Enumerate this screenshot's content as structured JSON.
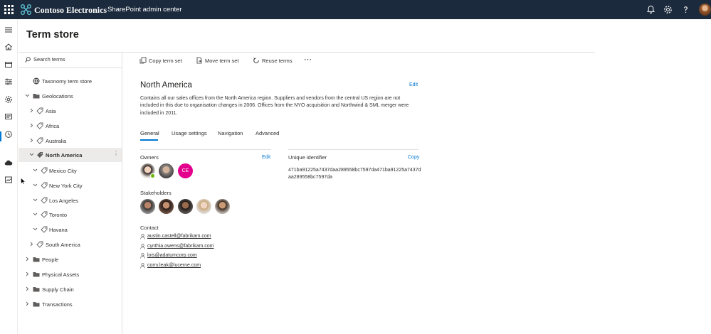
{
  "header": {
    "org_name": "Contoso Electronics",
    "app_name": "SharePoint admin center",
    "icons": [
      "waffle-icon",
      "bell-icon",
      "gear-icon",
      "help-icon",
      "profile-avatar"
    ]
  },
  "left_rail": {
    "icons": [
      "hamburger-icon",
      "home-icon",
      "sites-icon",
      "policies-icon",
      "settings-icon",
      "content-services-icon",
      "migration-icon",
      "more-features-icon",
      "onedrive-icon",
      "reports-icon"
    ],
    "active": "content-services-icon"
  },
  "page": {
    "title": "Term store"
  },
  "tree": {
    "search_placeholder": "Search terms",
    "items": [
      {
        "label": "Taxonomy term store",
        "icon": "globe-icon"
      },
      {
        "label": "Geolocations",
        "icon": "folder-icon",
        "expanded": true
      },
      {
        "label": "Asia",
        "icon": "term-set-icon"
      },
      {
        "label": "Africa",
        "icon": "term-set-icon"
      },
      {
        "label": "Australia",
        "icon": "term-set-icon"
      },
      {
        "label": "North America",
        "icon": "term-set-icon",
        "selected": true,
        "expanded": true
      },
      {
        "label": "Mexico City",
        "icon": "term-icon"
      },
      {
        "label": "New York City",
        "icon": "term-icon"
      },
      {
        "label": "Los Angeles",
        "icon": "term-icon"
      },
      {
        "label": "Toronto",
        "icon": "term-icon"
      },
      {
        "label": "Havana",
        "icon": "term-icon"
      },
      {
        "label": "South America",
        "icon": "term-set-icon"
      },
      {
        "label": "People",
        "icon": "folder-icon"
      },
      {
        "label": "Physical Assets",
        "icon": "folder-icon"
      },
      {
        "label": "Supply Chain",
        "icon": "folder-icon"
      },
      {
        "label": "Transactions",
        "icon": "folder-icon"
      }
    ]
  },
  "command_bar": {
    "copy_term_set": "Copy term set",
    "move_term_set": "Move term set",
    "reuse_terms": "Reuse terms",
    "more": "⋯"
  },
  "detail": {
    "title": "North America",
    "edit_label": "Edit",
    "description": "Contains all our sales offices from the North America region. Suppliers and vendors from the central US region are not included in this due to organisation changes in 2006. Offices from the NYO acquisition and Northwind & SML merger were included in 2011.",
    "tabs": [
      "General",
      "Usage settings",
      "Navigation",
      "Advanced"
    ],
    "active_tab": "General",
    "owners_label": "Owners",
    "owners_edit": "Edit",
    "owner_initials": "CE",
    "uid_label": "Unique identifier",
    "uid_copy": "Copy",
    "uid_value": "471ba91225a7437daa289558bc7597da471ba91225a7437daa289558bc7597da",
    "stakeholders_label": "Stakeholders",
    "contact_label": "Contact",
    "contacts": [
      "austin.castell@fabrikam.com",
      "cynthia.owens@fabrikam.com",
      "lois@adatumcorp.com",
      "corry.leak@lucerne.com"
    ]
  },
  "colors": {
    "header_bg": "#1b2a3c",
    "accent": "#0078d4",
    "initials_bg": "#e3008c",
    "presence": "#6bb700"
  }
}
